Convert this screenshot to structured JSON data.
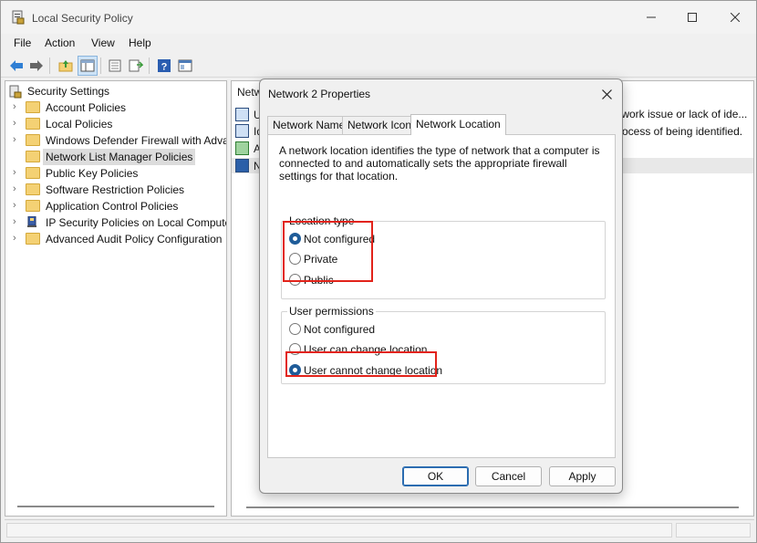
{
  "window": {
    "title": "Local Security Policy",
    "icons": {
      "app": "security-policy-icon",
      "minimize": "minimize-icon",
      "maximize": "maximize-icon",
      "close": "close-icon"
    }
  },
  "menu": {
    "items": [
      "File",
      "Action",
      "View",
      "Help"
    ]
  },
  "toolbar": {
    "buttons": [
      "back-arrow-icon",
      "forward-arrow-icon",
      "up-folder-icon",
      "show-hide-tree-icon",
      "properties-icon",
      "export-list-icon",
      "help-icon",
      "console-icon"
    ]
  },
  "tree": {
    "root": "Security Settings",
    "items": [
      {
        "label": "Account Policies",
        "icon": "folder-lock-icon"
      },
      {
        "label": "Local Policies",
        "icon": "folder-lock-icon"
      },
      {
        "label": "Windows Defender Firewall with Adva",
        "icon": "folder-icon"
      },
      {
        "label": "Network List Manager Policies",
        "icon": "folder-icon"
      },
      {
        "label": "Public Key Policies",
        "icon": "folder-icon"
      },
      {
        "label": "Software Restriction Policies",
        "icon": "folder-icon"
      },
      {
        "label": "Application Control Policies",
        "icon": "folder-icon"
      },
      {
        "label": "IP Security Policies on Local Compute",
        "icon": "ip-security-icon"
      },
      {
        "label": "Advanced Audit Policy Configuration",
        "icon": "folder-icon"
      }
    ],
    "selected": "Network List Manager Policies"
  },
  "right_pane": {
    "header": "Netw",
    "rows": [
      {
        "text": "U"
      },
      {
        "text": "Id"
      },
      {
        "text": "A"
      },
      {
        "text": "N"
      }
    ],
    "desc_line1": "twork issue or lack of ide...",
    "desc_line2": "ocess of being identified."
  },
  "dialog": {
    "title": "Network 2 Properties",
    "tabs": [
      "Network Name",
      "Network Icon",
      "Network Location"
    ],
    "active_tab": "Network Location",
    "intro": "A network location identifies the type of network that a computer is connected to and automatically sets the appropriate firewall settings for that location.",
    "location_type": {
      "label": "Location type",
      "options": [
        "Not configured",
        "Private",
        "Public"
      ],
      "selected": "Not configured"
    },
    "user_permissions": {
      "label": "User permissions",
      "options": [
        "Not configured",
        "User can change location",
        "User cannot change location"
      ],
      "selected": "User cannot change location"
    },
    "buttons": {
      "ok": "OK",
      "cancel": "Cancel",
      "apply": "Apply"
    },
    "highlight_color": "#e2231a"
  }
}
